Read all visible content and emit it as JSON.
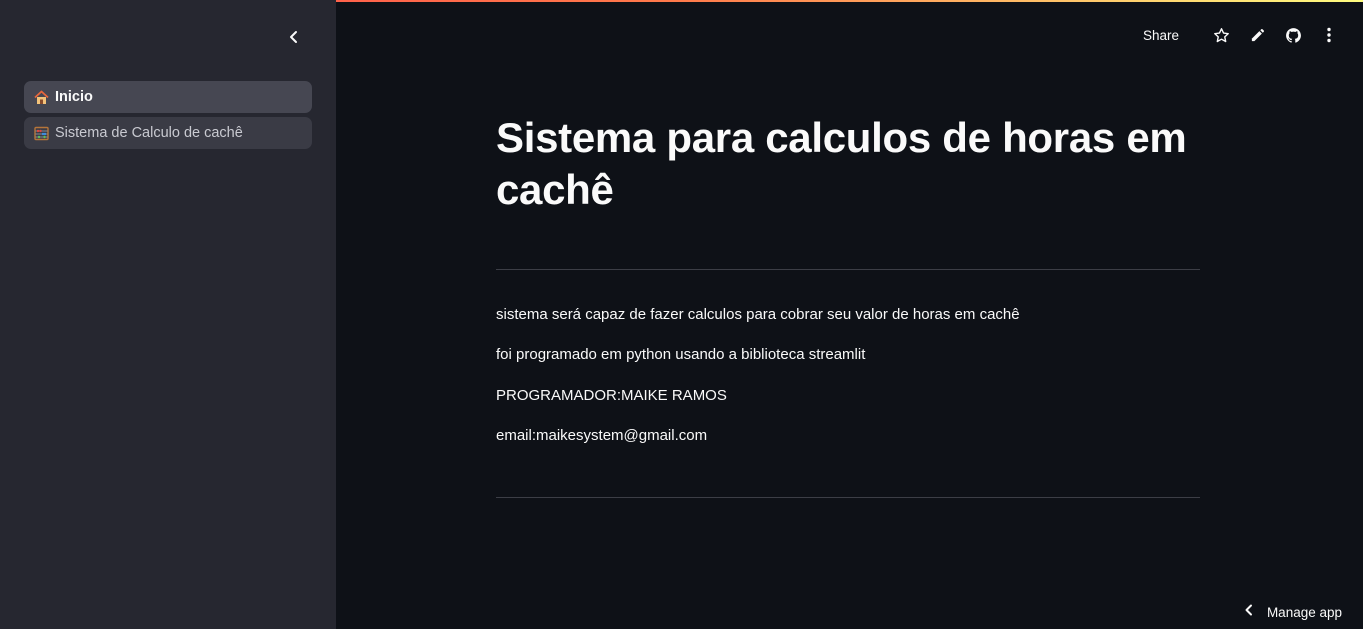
{
  "colors": {
    "background": "#0e1117",
    "sidebar": "#262730",
    "text": "#fafafa",
    "nav_active": "#464752"
  },
  "sidebar": {
    "collapse_icon": "chevron-left-icon",
    "items": [
      {
        "icon": "house-icon",
        "label": "Inicio",
        "active": true
      },
      {
        "icon": "abacus-icon",
        "label": "Sistema de Calculo de cachê",
        "active": false
      }
    ]
  },
  "header": {
    "share_label": "Share",
    "icons": [
      "star-icon",
      "pencil-icon",
      "github-icon",
      "more-vertical-icon"
    ]
  },
  "main": {
    "title": "Sistema para calculos de horas em cachê",
    "paragraphs": [
      "sistema será capaz de fazer calculos para cobrar seu valor de horas em cachê",
      "foi programado em python usando a biblioteca streamlit",
      "PROGRAMADOR:MAIKE RAMOS",
      "email:maikesystem@gmail.com"
    ]
  },
  "footer": {
    "manage_label": "Manage app",
    "manage_icon": "chevron-left-icon"
  }
}
